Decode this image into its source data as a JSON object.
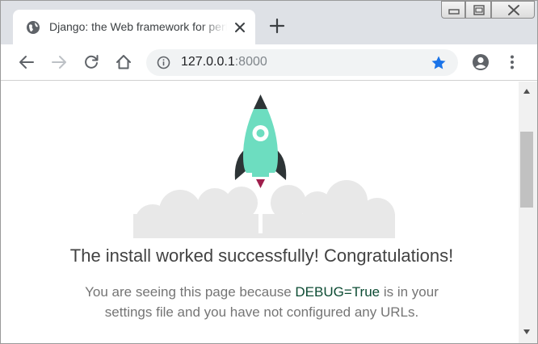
{
  "tab": {
    "title": "Django: the Web framework for perfectionists with deadlines."
  },
  "address_bar": {
    "host": "127.0.0.1",
    "port": ":8000"
  },
  "page": {
    "headline": "The install worked successfully! Congratulations!",
    "message_before": "You are seeing this page because ",
    "debug_link": "DEBUG=True",
    "message_after": " is in your settings file and you have not configured any URLs."
  },
  "colors": {
    "tabstrip": "#dee1e6",
    "star": "#1a73e8",
    "rocket_body": "#6dddc0",
    "rocket_dark": "#2d3436",
    "flame": "#9f1e4c",
    "cloud": "#e8e8e8"
  },
  "icons": {
    "tab_favicon": "globe-icon",
    "tab_close": "close-icon",
    "new_tab": "plus-icon",
    "back": "back-arrow-icon",
    "forward": "forward-arrow-icon",
    "reload": "reload-icon",
    "home": "home-icon",
    "site_info": "info-icon",
    "bookmark": "star-icon",
    "profile": "account-icon",
    "menu": "kebab-menu-icon"
  }
}
